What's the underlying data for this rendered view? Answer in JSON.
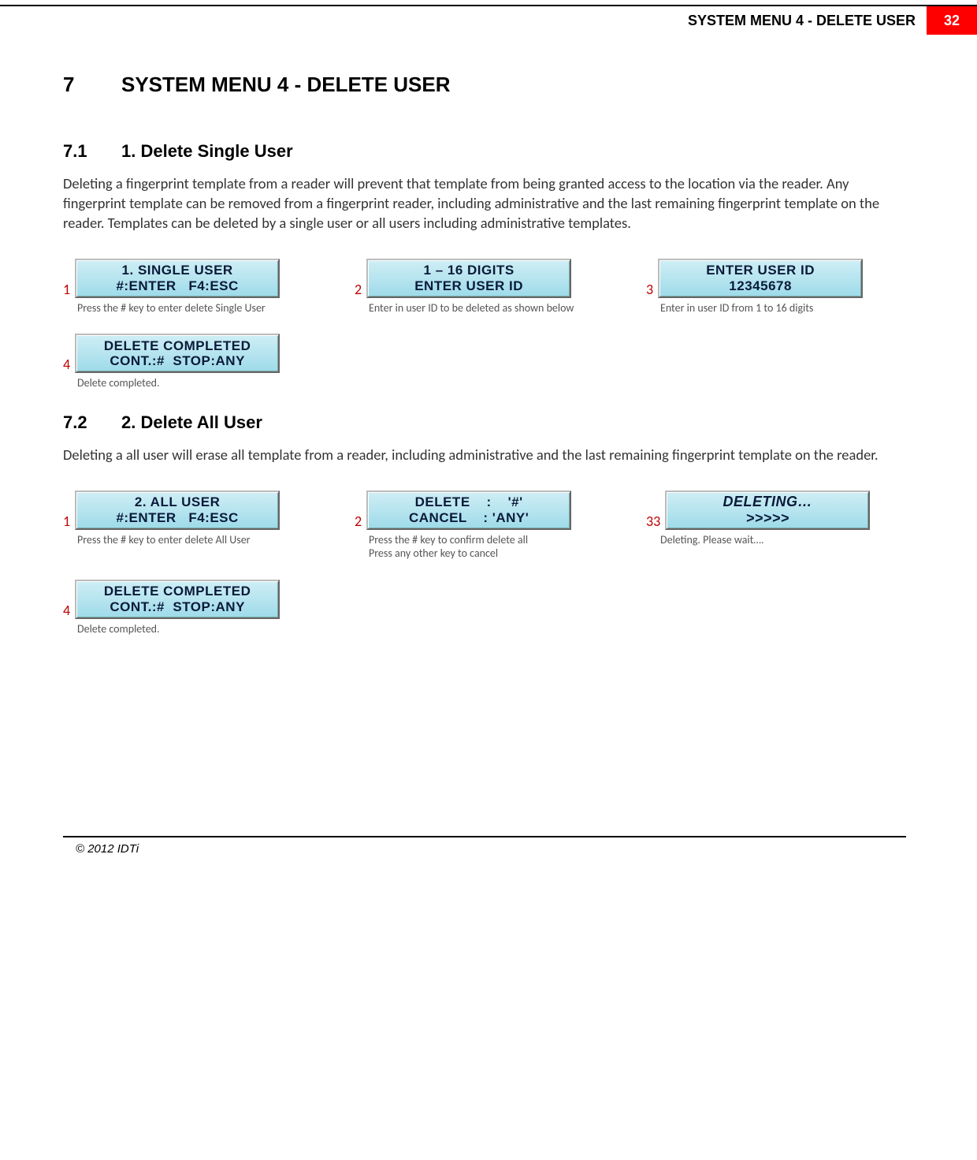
{
  "header": {
    "title": "SYSTEM MENU 4 - DELETE USER",
    "page_number": "32"
  },
  "chapter": {
    "number": "7",
    "title": "SYSTEM MENU 4 - DELETE USER"
  },
  "sections": [
    {
      "number": "7.1",
      "title": "1. Delete Single User",
      "body": "Deleting a fingerprint template from a reader will prevent that template from being granted access to the location via the reader. Any fingerprint template can be removed from a fingerprint reader, including administrative and the last remaining fingerprint template on the reader. Templates can be deleted by a single user or all users including administrative templates.",
      "steps": [
        {
          "num": "1",
          "lcd_lines": [
            "1. SINGLE USER",
            "#:ENTER   F4:ESC"
          ],
          "caption": "Press the # key to enter delete Single User"
        },
        {
          "num": "2",
          "lcd_lines": [
            "1 – 16 DIGITS",
            "ENTER USER ID"
          ],
          "caption": "Enter in user ID to be deleted as shown below"
        },
        {
          "num": "3",
          "lcd_lines": [
            "ENTER USER ID",
            "12345678"
          ],
          "caption": "Enter in user ID from 1 to 16 digits"
        },
        {
          "num": "4",
          "lcd_lines": [
            "DELETE COMPLETED",
            "CONT.:#  STOP:ANY"
          ],
          "caption": "Delete completed."
        }
      ]
    },
    {
      "number": "7.2",
      "title": "2. Delete All User",
      "body": "Deleting a all user will erase all template from a reader, including administrative and the last remaining fingerprint template on the reader.",
      "steps": [
        {
          "num": "1",
          "lcd_lines": [
            "2. ALL USER",
            "#:ENTER   F4:ESC"
          ],
          "caption": "Press the # key to enter delete All User"
        },
        {
          "num": "2",
          "lcd_lines": [
            "DELETE    :    '#'",
            "CANCEL    : 'ANY'"
          ],
          "caption": "Press the # key to confirm delete all\nPress any other key to cancel"
        },
        {
          "num": "33",
          "lcd_lines": [
            "DELETING…",
            ">>>>>"
          ],
          "italic": true,
          "caption": "Deleting. Please wait…."
        },
        {
          "num": "4",
          "lcd_lines": [
            "DELETE COMPLETED",
            "CONT.:#  STOP:ANY"
          ],
          "caption": "Delete completed."
        }
      ]
    }
  ],
  "footer": "© 2012 IDTi"
}
